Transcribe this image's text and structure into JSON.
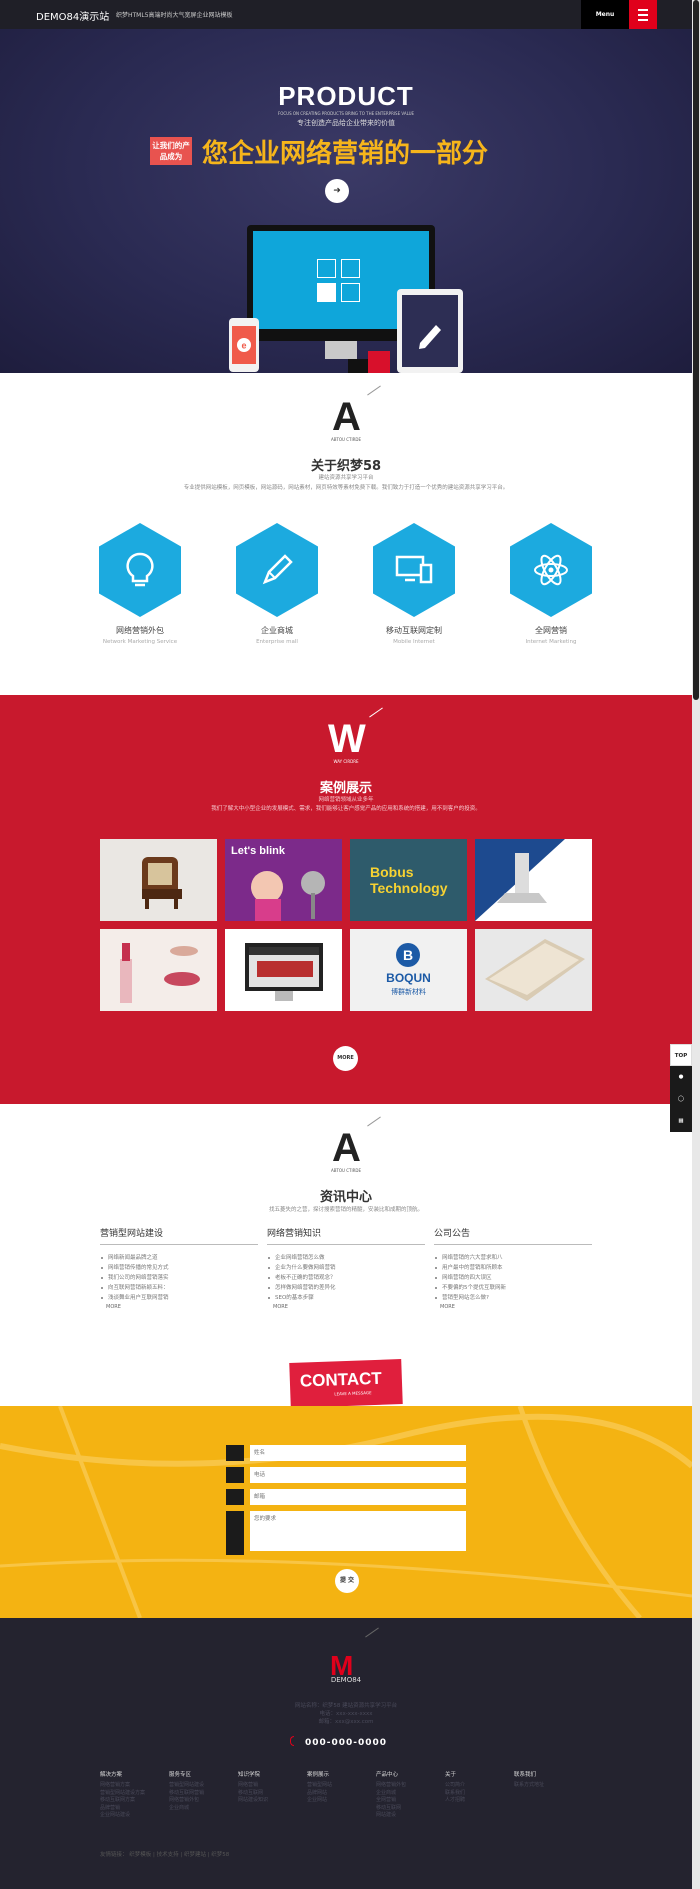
{
  "header": {
    "logo": "DEMO84演示站",
    "slogan": "织梦HTML5高端时尚大气宽屏企业网站模板",
    "menu_label": "Menu"
  },
  "hero": {
    "title": "PRODUCT",
    "subtitle": "FOCUS ON CREATING PRODUCTS BRING TO THE ENTERPRISE VALUE",
    "subtitle_cn": "专注创造产品给企业带来的价值",
    "tag": "让我们的产品成为",
    "headline": "您企业网络营销的一部分",
    "play_icon": "arrow-right-icon"
  },
  "about": {
    "logo_letter": "A",
    "logo_sub": "ABTOU CTIRDE",
    "title": "关于织梦58",
    "tagline": "建站资源共享学习平台",
    "desc": "专业提供网站模板，网页模板，网站源码，网站素材，网页特效等素材免费下载。我们致力于打造一个优秀的建站资源共享学习平台。",
    "services": [
      {
        "cn": "网络营销外包",
        "en": "Network Marketing Service",
        "icon": "lightbulb-icon"
      },
      {
        "cn": "企业商城",
        "en": "Enterprise mall",
        "icon": "pencil-icon"
      },
      {
        "cn": "移动互联网定制",
        "en": "Mobile Internet",
        "icon": "devices-icon"
      },
      {
        "cn": "全网营销",
        "en": "Internet Marketing",
        "icon": "atom-icon"
      }
    ]
  },
  "cases": {
    "logo_letter": "W",
    "logo_sub": "WAY CIRDRE",
    "title": "案例展示",
    "tagline": "网络营销领域从业多年",
    "desc": "我们了解大中小型企业的发展模式、需求，我们能够让客户感觉产品的应用和系统的搭建，用不到客户的投资。",
    "more_label": "MORE",
    "tiles": [
      {
        "name": "chair",
        "text": ""
      },
      {
        "name": "letsblink",
        "text": "Let's blink"
      },
      {
        "name": "bobus",
        "text": "Bobus Technology"
      },
      {
        "name": "hood",
        "text": ""
      },
      {
        "name": "lipstick",
        "text": ""
      },
      {
        "name": "monitor-site",
        "text": ""
      },
      {
        "name": "boqun",
        "text": "BOQUN",
        "text2": "博群新材料"
      },
      {
        "name": "device",
        "text": ""
      }
    ]
  },
  "news": {
    "logo_letter": "A",
    "logo_sub": "ABTOU CTIRDE",
    "title": "资讯中心",
    "desc": "找五菱失的之营，探讨搜索营销的精髓，安装比和成期的顶航。",
    "more_label": "MORE",
    "columns": [
      {
        "heading": "营销型网站建设",
        "items": [
          "网络新闻最品牌之道",
          "网络营销传播的常见方式",
          "我们公司的网络营销落实",
          "向互联网营销新颖五料：",
          "浅谈舞业用户互联网营销"
        ]
      },
      {
        "heading": "网络营销知识",
        "items": [
          "企业网络营销怎么做",
          "企业为什么要做网络营销",
          "老板不正确的营销观念？",
          "怎样做网络营销的差异化",
          "SEO的基本步骤"
        ]
      },
      {
        "heading": "公司公告",
        "items": [
          "网络营销的六大营求和八",
          "用户最中的营销和所顾本",
          "网络营销的四大误区",
          "不要偏的5个提优互联网新",
          "营销型网站怎么做?"
        ]
      }
    ]
  },
  "contact": {
    "tab_title": "CONTACT",
    "tab_sub": "LEAVE A MESSAGE",
    "fields": [
      {
        "placeholder": "姓名"
      },
      {
        "placeholder": "电话"
      },
      {
        "placeholder": "邮箱"
      },
      {
        "placeholder": "您的要求"
      }
    ],
    "submit_label": "提 交"
  },
  "footer": {
    "logo_letter": "M",
    "brand": "DEMO84",
    "info": [
      "网站名称：织梦58 建站资源共享学习平台",
      "电话：xxx-xxx-xxxx",
      "邮箱：xxx@xxx.com"
    ],
    "phone": "000-000-0000",
    "columns": [
      {
        "heading": "解决方案",
        "links": [
          "网络营销方案",
          "营销型网站建设方案",
          "移动互联网方案",
          "品牌营销",
          "企业网站建设"
        ]
      },
      {
        "heading": "服务专区",
        "links": [
          "营销型网站建设",
          "移动互联网营销",
          "网络营销外包",
          "企业商城"
        ]
      },
      {
        "heading": "知识学院",
        "links": [
          "网络营销",
          "移动互联网",
          "网站建设知识"
        ]
      },
      {
        "heading": "案例展示",
        "links": [
          "营销型网站",
          "品牌网站",
          "企业网站"
        ]
      },
      {
        "heading": "产品中心",
        "links": [
          "网络营销外包",
          "企业商城",
          "全网营销",
          "移动互联网",
          "网站建设"
        ]
      },
      {
        "heading": "关于",
        "links": [
          "公司简介",
          "联系我们",
          "人才招聘"
        ]
      },
      {
        "heading": "联系我们",
        "links": [
          "联系方式地址"
        ]
      }
    ],
    "bottom_links": "友情链接：  织梦模板  |  技术支持  |  织梦建站  |  织梦58"
  },
  "side_tools": [
    "TOP",
    "qq-icon",
    "chat-icon",
    "qrcode-icon"
  ]
}
